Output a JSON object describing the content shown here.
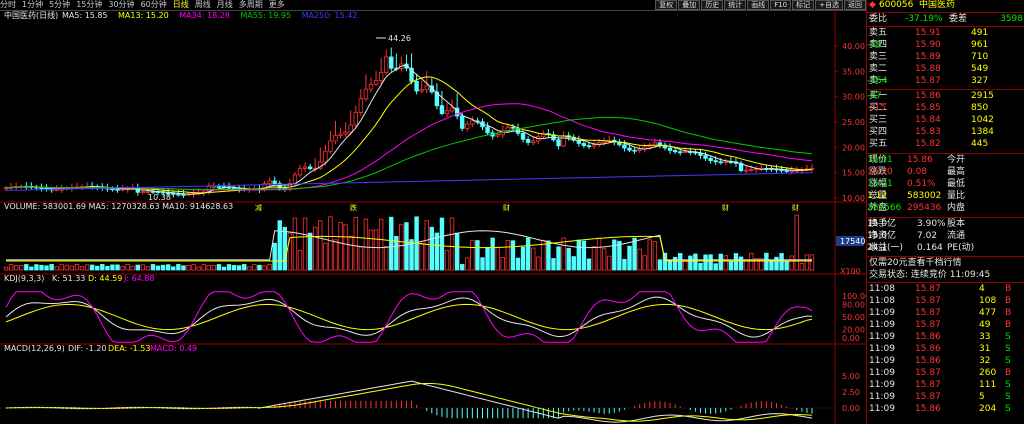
{
  "toolbar": {
    "periods": [
      "分时",
      "1分钟",
      "5分钟",
      "15分钟",
      "30分钟",
      "60分钟",
      "日线",
      "周线",
      "月线",
      "多周期",
      "更多"
    ],
    "active_index": 6,
    "buttons": [
      "复权",
      "叠加",
      "历史",
      "统计",
      "画线",
      "F10",
      "标记",
      "+自选",
      "返回"
    ]
  },
  "main": {
    "title": "中国医药(日线)",
    "ma_labels": [
      {
        "text": "MA5: 15.85",
        "color": "#e6e6e6"
      },
      {
        "text": "MA13: 15.20",
        "color": "#ffff00"
      },
      {
        "text": "MA34: 18.28",
        "color": "#ff00ff"
      },
      {
        "text": "MA55: 19.95",
        "color": "#00c800"
      },
      {
        "text": "MA250: 15.42",
        "color": "#3c3cff"
      }
    ],
    "y_ticks": [
      "40.00",
      "35.00",
      "30.00",
      "25.00",
      "20.00",
      "15.00",
      "10.00"
    ],
    "y_values": [
      40,
      35,
      30,
      25,
      20,
      15,
      10
    ],
    "high_label": "44.26",
    "low_label": "10.38",
    "markers": [
      {
        "text": "减",
        "x": 255
      },
      {
        "text": "跌",
        "x": 350
      },
      {
        "text": "财",
        "x": 503
      },
      {
        "text": "财",
        "x": 722
      },
      {
        "text": "财",
        "x": 792
      }
    ]
  },
  "volume": {
    "label": "VOLUME: 583001.69  MA5: 1270328.63  MA10: 914628.63",
    "tag": "17540",
    "unit": "X100"
  },
  "kdj": {
    "label_prefix": "KDJ(9,3,3)",
    "k": "K: 51.33",
    "d": "D: 44.59",
    "j": "J: 64.88",
    "y_ticks": [
      "100.00",
      "80.00",
      "50.00",
      "20.00",
      "0.00"
    ],
    "y_values": [
      100,
      80,
      50,
      20,
      0
    ]
  },
  "macd": {
    "label_prefix": "MACD(12,26,9)",
    "dif": "DIF: -1.20",
    "dea": "DEA: -1.53",
    "macd": "MACD: 0.49",
    "y_ticks": [
      "5.00",
      "2.50",
      "0.00"
    ],
    "y_values": [
      5,
      2.5,
      0
    ]
  },
  "quote": {
    "code": "600056",
    "name": "中国医药",
    "weibi_label": "委比",
    "weibi": "-37.19%",
    "weicha_label": "委差",
    "weicha": "3598",
    "asks": [
      {
        "label": "卖五",
        "price": "15.91",
        "vol": "491",
        "chg": ""
      },
      {
        "label": "卖四",
        "price": "15.90",
        "vol": "961",
        "chg": "-19"
      },
      {
        "label": "卖三",
        "price": "15.89",
        "vol": "710",
        "chg": ""
      },
      {
        "label": "卖二",
        "price": "15.88",
        "vol": "549",
        "chg": ""
      },
      {
        "label": "卖一",
        "price": "15.87",
        "vol": "327",
        "chg": "-164"
      }
    ],
    "bids": [
      {
        "label": "买一",
        "price": "15.86",
        "vol": "2915",
        "chg": "-87"
      },
      {
        "label": "买二",
        "price": "15.85",
        "vol": "850",
        "chg": "+15"
      },
      {
        "label": "买三",
        "price": "15.84",
        "vol": "1042",
        "chg": ""
      },
      {
        "label": "买四",
        "price": "15.83",
        "vol": "1384",
        "chg": ""
      },
      {
        "label": "买五",
        "price": "15.82",
        "vol": "445",
        "chg": ""
      }
    ],
    "stats": [
      {
        "l1": "现价",
        "v1": "15.86",
        "c1": "red",
        "l2": "今开",
        "v2": "15.51",
        "c2": "grn"
      },
      {
        "l1": "涨跌",
        "v1": "0.08",
        "c1": "red",
        "l2": "最高",
        "v2": "16.20",
        "c2": "red"
      },
      {
        "l1": "涨幅",
        "v1": "0.51%",
        "c1": "red",
        "l2": "最低",
        "v2": "15.51",
        "c2": "grn"
      },
      {
        "l1": "总量",
        "v1": "583002",
        "c1": "yel",
        "l2": "量比",
        "v2": "1.12",
        "c2": "yel"
      },
      {
        "l1": "外盘",
        "v1": "295436",
        "c1": "red",
        "l2": "内盘",
        "v2": "287566",
        "c2": "grn"
      }
    ],
    "stats2": [
      {
        "l1": "换手",
        "v1": "3.90%",
        "l2": "股本",
        "v2": "15.0亿"
      },
      {
        "l1": "净资",
        "v1": "7.02",
        "l2": "流通",
        "v2": "15.0亿"
      },
      {
        "l1": "收益(一)",
        "v1": "0.164",
        "l2": "PE(动)",
        "v2": "24.1"
      }
    ],
    "notice": "仅需20元查看千档行情",
    "status_label": "交易状态: 连续竞价 11:09:45",
    "ticks": [
      {
        "t": "11:08",
        "p": "15.87",
        "v": "4",
        "s": "B"
      },
      {
        "t": "11:08",
        "p": "15.87",
        "v": "108",
        "s": "B"
      },
      {
        "t": "11:09",
        "p": "15.87",
        "v": "477",
        "s": "B"
      },
      {
        "t": "11:09",
        "p": "15.87",
        "v": "49",
        "s": "B"
      },
      {
        "t": "11:09",
        "p": "15.86",
        "v": "33",
        "s": "S"
      },
      {
        "t": "11:09",
        "p": "15.86",
        "v": "31",
        "s": "S"
      },
      {
        "t": "11:09",
        "p": "15.86",
        "v": "32",
        "s": "S"
      },
      {
        "t": "11:09",
        "p": "15.87",
        "v": "260",
        "s": "B"
      },
      {
        "t": "11:09",
        "p": "15.87",
        "v": "111",
        "s": "S"
      },
      {
        "t": "11:09",
        "p": "15.87",
        "v": "5",
        "s": "S"
      },
      {
        "t": "11:09",
        "p": "15.86",
        "v": "204",
        "s": "S"
      }
    ]
  }
}
